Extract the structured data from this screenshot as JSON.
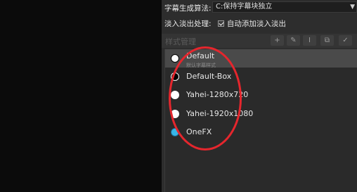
{
  "settings": {
    "algorithm_label": "字幕生成算法:",
    "algorithm_value": "C:保持字幕块独立",
    "fade_label": "淡入淡出处理:",
    "fade_option": "自动添加淡入淡出"
  },
  "style_manager": {
    "title": "样式管理",
    "tools": [
      "+",
      "✎",
      "I",
      "⧉",
      "✓"
    ],
    "items": [
      {
        "name": "Default",
        "sub": "默认字幕样式",
        "dot_color": "#ffffff"
      },
      {
        "name": "Default-Box",
        "dot_color": "#000000"
      },
      {
        "name": "Yahei-1280x720",
        "dot_color": "#ffffff"
      },
      {
        "name": "Yahei-1920x1080",
        "dot_color": "#ffffff"
      },
      {
        "name": "OneFX",
        "dot_color": "#38b6e8"
      }
    ]
  },
  "colors": {
    "annotation": "#e5262d",
    "selection": "#4a4a4a"
  }
}
